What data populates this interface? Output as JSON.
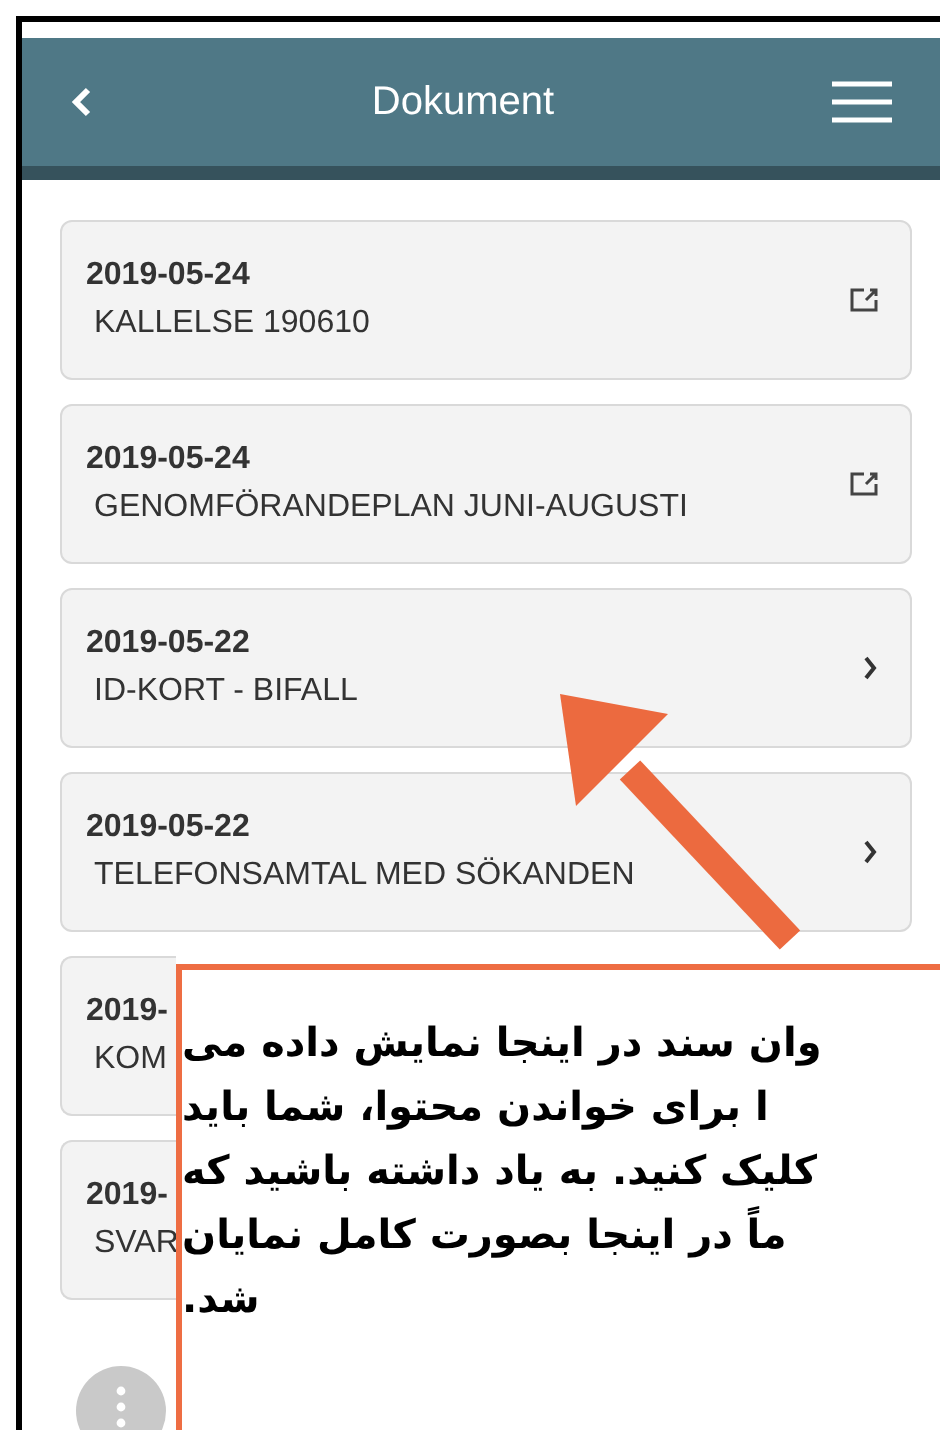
{
  "header": {
    "title": "Dokument"
  },
  "documents": [
    {
      "date": "2019-05-24",
      "title": "KALLELSE 190610",
      "kind": "external"
    },
    {
      "date": "2019-05-24",
      "title": "GENOMFÖRANDEPLAN JUNI-AUGUSTI",
      "kind": "external"
    },
    {
      "date": "2019-05-22",
      "title": "ID-KORT - BIFALL",
      "kind": "detail"
    },
    {
      "date": "2019-05-22",
      "title": "TELEFONSAMTAL MED SÖKANDEN",
      "kind": "detail"
    },
    {
      "date": "2019-",
      "title": "KOM",
      "kind": "covered"
    },
    {
      "date": "2019-",
      "title": "SVAR",
      "kind": "covered"
    }
  ],
  "callout": {
    "lines": [
      "وان سند در اینجا نمایش داده می",
      "ا برای خواندن محتوا، شما باید",
      "کلیک کنید. به یاد داشته باشید که",
      "ماً در اینجا بصورت کامل نمایان",
      "شد."
    ]
  }
}
